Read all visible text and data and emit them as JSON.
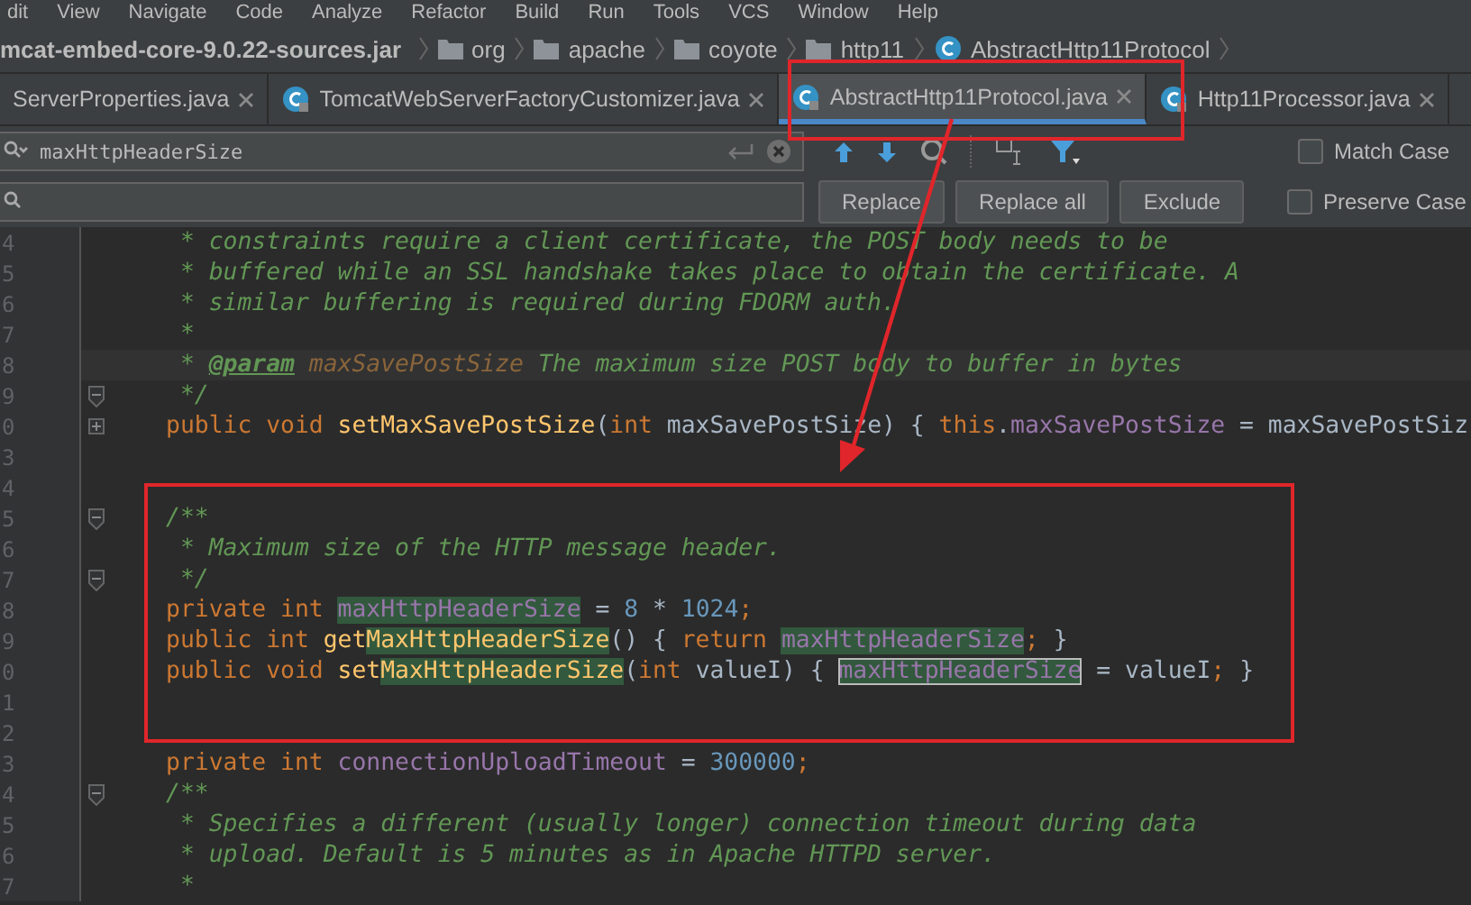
{
  "menu": [
    "dit",
    "View",
    "Navigate",
    "Code",
    "Analyze",
    "Refactor",
    "Build",
    "Run",
    "Tools",
    "VCS",
    "Window",
    "Help"
  ],
  "breadcrumb": [
    {
      "kind": "jar",
      "label": "mcat-embed-core-9.0.22-sources.jar"
    },
    {
      "kind": "folder",
      "label": "org"
    },
    {
      "kind": "folder",
      "label": "apache"
    },
    {
      "kind": "folder",
      "label": "coyote"
    },
    {
      "kind": "folder",
      "label": "http11"
    },
    {
      "kind": "class",
      "label": "AbstractHttp11Protocol"
    }
  ],
  "tabs": [
    {
      "label": "ServerProperties.java",
      "icon": false,
      "selected": false
    },
    {
      "label": "TomcatWebServerFactoryCustomizer.java",
      "icon": true,
      "selected": false
    },
    {
      "label": "AbstractHttp11Protocol.java",
      "icon": true,
      "selected": true
    },
    {
      "label": "Http11Processor.java",
      "icon": true,
      "selected": false
    }
  ],
  "search": {
    "value": "maxHttpHeaderSize",
    "match_case": false,
    "preserve_case": false,
    "match_case_label": "Match Case",
    "preserve_case_label": "Preserve Case"
  },
  "replace_buttons": [
    "Replace",
    "Replace all",
    "Exclude"
  ],
  "lines": [
    {
      "number": "4",
      "tokens": [
        {
          "kind": "comment",
          "text": " * constraints require a client certificate, the POST body needs to be"
        }
      ]
    },
    {
      "number": "5",
      "tokens": [
        {
          "kind": "comment",
          "text": " * buffered while an SSL handshake takes place to obtain the certificate. A"
        }
      ]
    },
    {
      "number": "6",
      "tokens": [
        {
          "kind": "comment",
          "text": " * similar buffering is required during FDORM auth."
        }
      ]
    },
    {
      "number": "7",
      "tokens": [
        {
          "kind": "comment",
          "text": " *"
        }
      ]
    },
    {
      "number": "8",
      "current": true,
      "tokens": [
        {
          "kind": "comment",
          "text": " * "
        },
        {
          "kind": "doctag",
          "text": "@param"
        },
        {
          "kind": "docparam",
          "text": " maxSavePostSize"
        },
        {
          "kind": "comment",
          "text": " The maximum size POST body to buffer in bytes"
        }
      ]
    },
    {
      "number": "9",
      "foldable": true,
      "collapsed": false,
      "tokens": [
        {
          "kind": "comment",
          "text": " */"
        }
      ]
    },
    {
      "number": "0",
      "foldable": true,
      "collapsed": true,
      "tokens": [
        {
          "kind": "keyword",
          "text": "public void "
        },
        {
          "kind": "method",
          "text": "setMaxSavePostSize"
        },
        {
          "kind": "plain",
          "text": "("
        },
        {
          "kind": "keyword",
          "text": "int"
        },
        {
          "kind": "plain",
          "text": " maxSavePostSize) { "
        },
        {
          "kind": "keyword",
          "text": "this"
        },
        {
          "kind": "plain",
          "text": "."
        },
        {
          "kind": "field",
          "text": "maxSavePostSize"
        },
        {
          "kind": "plain",
          "text": " = maxSavePostSiz"
        }
      ]
    },
    {
      "number": "3"
    },
    {
      "number": "4"
    },
    {
      "number": "5",
      "foldable": true,
      "collapsed": false,
      "tokens": [
        {
          "kind": "comment",
          "text": "/**"
        }
      ]
    },
    {
      "number": "6",
      "tokens": [
        {
          "kind": "comment",
          "text": " * Maximum size of the HTTP message header."
        }
      ]
    },
    {
      "number": "7",
      "foldable": true,
      "collapsed": false,
      "tokens": [
        {
          "kind": "comment",
          "text": " */"
        }
      ]
    },
    {
      "number": "8",
      "tokens": [
        {
          "kind": "keyword",
          "text": "private int "
        },
        {
          "kind": "field",
          "text": "maxHttpHeaderSize",
          "match": true
        },
        {
          "kind": "plain",
          "text": " = "
        },
        {
          "kind": "number",
          "text": "8"
        },
        {
          "kind": "plain",
          "text": " * "
        },
        {
          "kind": "number",
          "text": "1024"
        },
        {
          "kind": "keyword",
          "text": ";"
        }
      ]
    },
    {
      "number": "9",
      "tokens": [
        {
          "kind": "keyword",
          "text": "public int "
        },
        {
          "kind": "method",
          "text": "get"
        },
        {
          "kind": "method",
          "text": "MaxHttpHeaderSize",
          "match": true
        },
        {
          "kind": "plain",
          "text": "() { "
        },
        {
          "kind": "keyword",
          "text": "return "
        },
        {
          "kind": "field",
          "text": "maxHttpHeaderSize",
          "match": true
        },
        {
          "kind": "keyword",
          "text": ";"
        },
        {
          "kind": "plain",
          "text": " }"
        }
      ]
    },
    {
      "number": "0",
      "tokens": [
        {
          "kind": "keyword",
          "text": "public void "
        },
        {
          "kind": "method",
          "text": "set"
        },
        {
          "kind": "method",
          "text": "MaxHttpHeaderSize",
          "match": true
        },
        {
          "kind": "plain",
          "text": "("
        },
        {
          "kind": "keyword",
          "text": "int"
        },
        {
          "kind": "plain",
          "text": " valueI) { "
        },
        {
          "kind": "field",
          "text": "maxHttpHeaderSize",
          "match": true,
          "current": true
        },
        {
          "kind": "plain",
          "text": " = valueI"
        },
        {
          "kind": "keyword",
          "text": ";"
        },
        {
          "kind": "plain",
          "text": " }"
        }
      ]
    },
    {
      "number": "1"
    },
    {
      "number": "2"
    },
    {
      "number": "3",
      "tokens": [
        {
          "kind": "keyword",
          "text": "private int "
        },
        {
          "kind": "field",
          "text": "connectionUploadTimeout"
        },
        {
          "kind": "plain",
          "text": " = "
        },
        {
          "kind": "number",
          "text": "300000"
        },
        {
          "kind": "keyword",
          "text": ";"
        }
      ]
    },
    {
      "number": "4",
      "foldable": true,
      "collapsed": false,
      "tokens": [
        {
          "kind": "comment",
          "text": "/**"
        }
      ]
    },
    {
      "number": "5",
      "tokens": [
        {
          "kind": "comment",
          "text": " * Specifies a different (usually longer) connection timeout during data"
        }
      ]
    },
    {
      "number": "6",
      "tokens": [
        {
          "kind": "comment",
          "text": " * upload. Default is 5 minutes as in Apache HTTPD server."
        }
      ]
    },
    {
      "number": "7",
      "tokens": [
        {
          "kind": "comment",
          "text": " *"
        }
      ]
    }
  ]
}
